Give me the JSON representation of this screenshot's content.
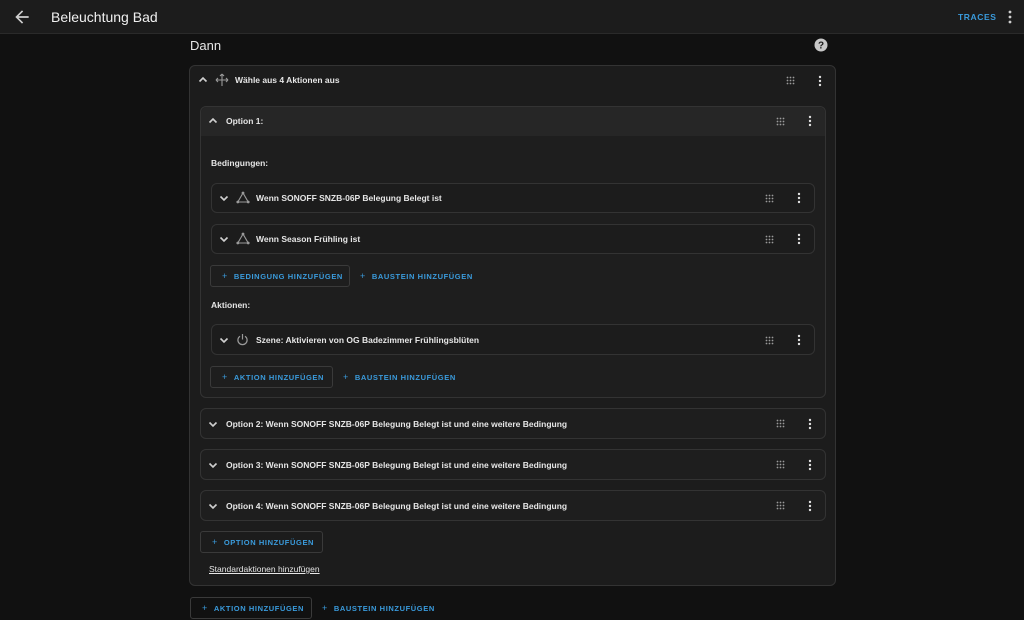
{
  "header": {
    "title": "Beleuchtung Bad",
    "traces_label": "TRACES"
  },
  "section": {
    "title": "Dann"
  },
  "choose": {
    "label": "Wähle aus 4 Aktionen aus"
  },
  "option1": {
    "label": "Option 1:",
    "conditions_heading": "Bedingungen:",
    "conditions": [
      {
        "label": "Wenn SONOFF SNZB-06P Belegung Belegt ist"
      },
      {
        "label": "Wenn Season Frühling ist"
      }
    ],
    "add_condition_label": "BEDINGUNG HINZUFÜGEN",
    "add_block_label": "BAUSTEIN HINZUFÜGEN",
    "actions_heading": "Aktionen:",
    "actions": [
      {
        "label": "Szene: Aktivieren von OG Badezimmer Frühlingsblüten"
      }
    ],
    "add_action_label": "AKTION HINZUFÜGEN",
    "add_action_block_label": "BAUSTEIN HINZUFÜGEN"
  },
  "options": [
    {
      "label": "Option 2: Wenn SONOFF SNZB-06P Belegung Belegt ist und eine weitere Bedingung"
    },
    {
      "label": "Option 3: Wenn SONOFF SNZB-06P Belegung Belegt ist und eine weitere Bedingung"
    },
    {
      "label": "Option 4: Wenn SONOFF SNZB-06P Belegung Belegt ist und eine weitere Bedingung"
    }
  ],
  "add_option_label": "OPTION HINZUFÜGEN",
  "default_actions_link": "Standardaktionen hinzufügen",
  "footer": {
    "add_action_label": "AKTION HINZUFÜGEN",
    "add_block_label": "BAUSTEIN HINZUFÜGEN"
  },
  "colors": {
    "accent": "#3a9bdc",
    "background": "#111111",
    "card": "#1c1c1c"
  },
  "icons": {
    "back": "arrow-left-icon",
    "menu": "dots-vertical-icon",
    "help": "help-circle-icon",
    "choose": "arrow-decision-icon",
    "condition": "state-triangle-icon",
    "scene": "power-icon",
    "drag": "drag-handle-icon"
  }
}
